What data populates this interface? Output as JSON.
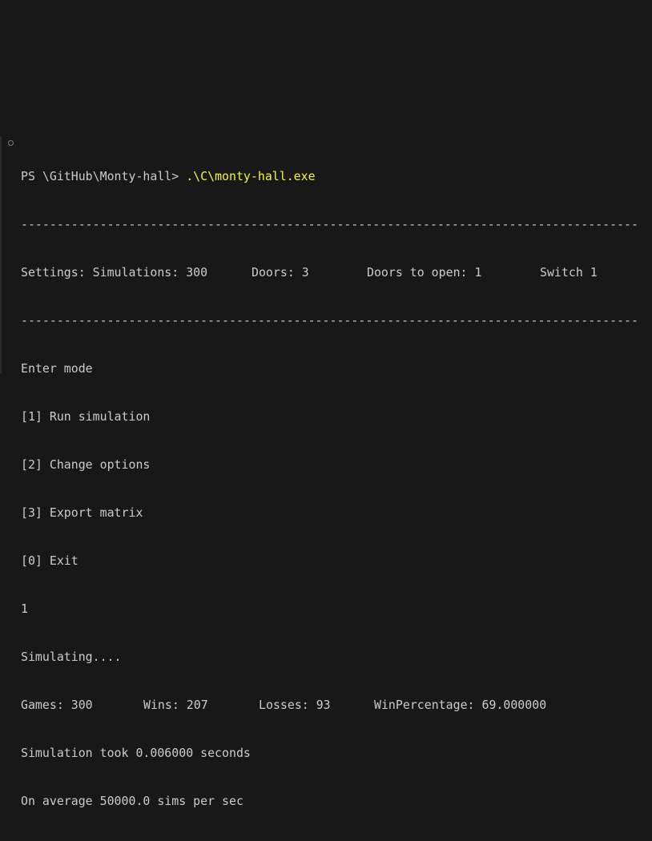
{
  "terminal": {
    "prompt": "PS \\GitHub\\Monty-hall> ",
    "command": ".\\C\\monty-hall.exe",
    "separator": "--------------------------------------------------------------------------------------",
    "settings": {
      "simulations": "Settings: Simulations: 300",
      "doors": "Doors: 3",
      "doors_to_open": "Doors to open: 1",
      "switch": "Switch 1"
    },
    "menu_title": "Enter mode",
    "menu_items": [
      "[1] Run simulation",
      "[2] Change options",
      "[3] Export matrix",
      "[0] Exit"
    ],
    "user_input": "1",
    "simulating": "Simulating....",
    "results": {
      "games": "Games: 300",
      "wins": "Wins: 207",
      "losses": "Losses: 93",
      "win_percentage": "WinPercentage: 69.000000"
    },
    "timing": "Simulation took 0.006000 seconds",
    "average": "On average 50000.0 sims per sec"
  },
  "colors": {
    "background": "#181818",
    "text": "#cccccc",
    "command": "#f5f543"
  }
}
